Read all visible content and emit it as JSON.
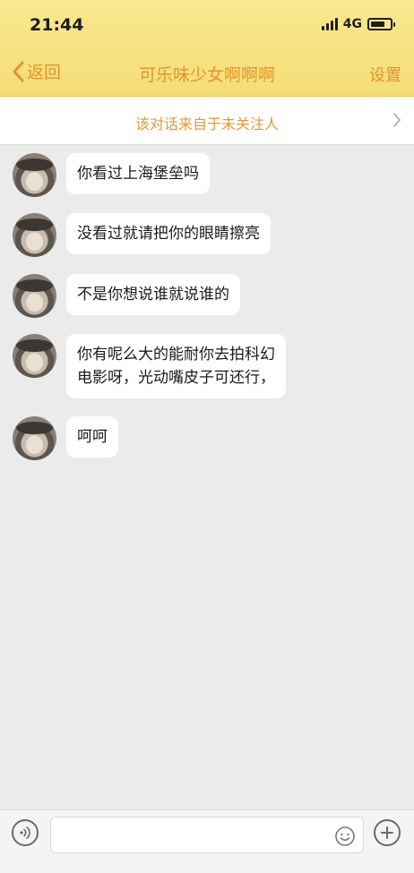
{
  "status_bar": {
    "time": "21:44",
    "network": "4G"
  },
  "header": {
    "back_label": "返回",
    "title": "可乐味少女啊啊啊",
    "settings_label": "设置"
  },
  "notice": {
    "text": "该对话来自于未关注人"
  },
  "messages": [
    {
      "text": "你看过上海堡垒吗"
    },
    {
      "text": "没看过就请把你的眼睛擦亮"
    },
    {
      "text": "不是你想说谁就说谁的"
    },
    {
      "text": "你有呢么大的能耐你去拍科幻\n电影呀，光动嘴皮子可还行，"
    },
    {
      "text": "呵呵"
    }
  ],
  "input": {
    "placeholder": ""
  },
  "icons": {
    "voice": "voice-icon",
    "emoji": "emoji-icon",
    "plus": "plus-icon",
    "back": "chevron-left-icon",
    "notice": "chevron-right-icon"
  },
  "colors": {
    "header_bg": "#f6dd77",
    "accent": "#e0962a",
    "chat_bg": "#ebebeb"
  }
}
